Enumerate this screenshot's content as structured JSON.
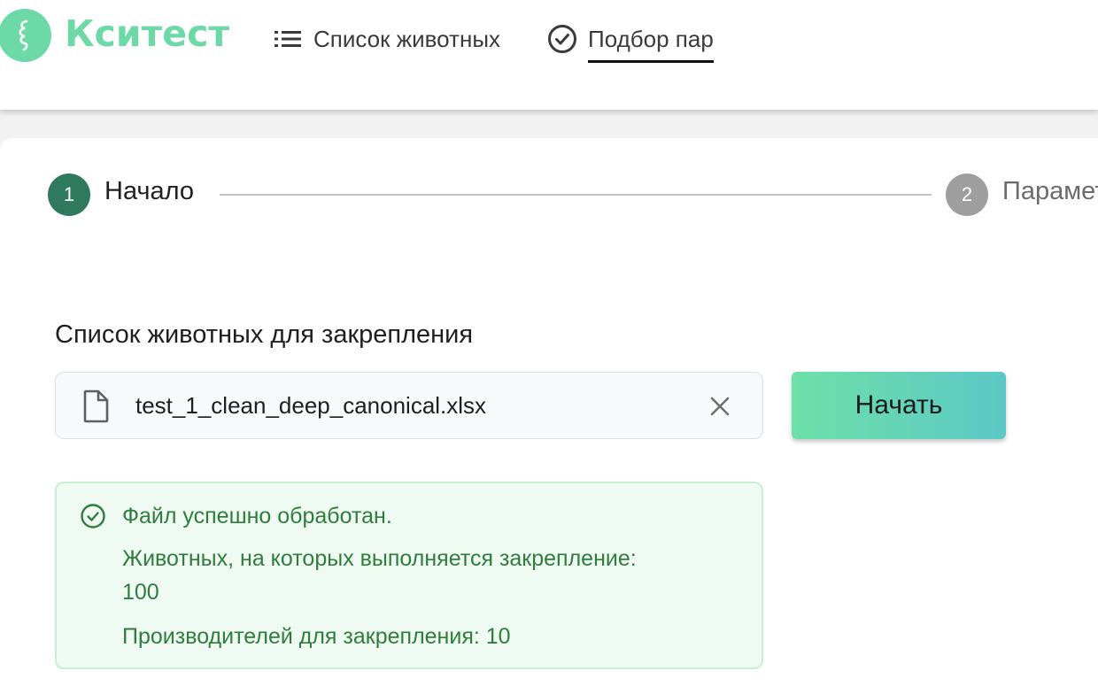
{
  "app": {
    "name": "Кситест",
    "brand_color": "#6dd9a6"
  },
  "nav": {
    "items": [
      {
        "label": "Список животных",
        "icon": "list-icon",
        "active": false
      },
      {
        "label": "Подбор пар",
        "icon": "check-circle-icon",
        "active": true
      }
    ]
  },
  "stepper": {
    "steps": [
      {
        "number": "1",
        "label": "Начало",
        "state": "active",
        "color": "#2f7a5f"
      },
      {
        "number": "2",
        "label": "Парамет",
        "state": "inactive",
        "color": "#9e9e9e"
      }
    ]
  },
  "section": {
    "title": "Список животных для закрепления"
  },
  "file_input": {
    "icon": "file-icon",
    "file_name": "test_1_clean_deep_canonical.xlsx",
    "clear_icon": "close-icon"
  },
  "start_button": {
    "label": "Начать"
  },
  "alert": {
    "icon": "check-circle-icon",
    "title": "Файл успешно обработан.",
    "animals_label": "Животных, на которых выполняется закрепление:",
    "animals_value": "100",
    "producers": "Производителей для закрепления: 10",
    "text_color": "#2f7d3d",
    "background_color": "#effbf2"
  }
}
